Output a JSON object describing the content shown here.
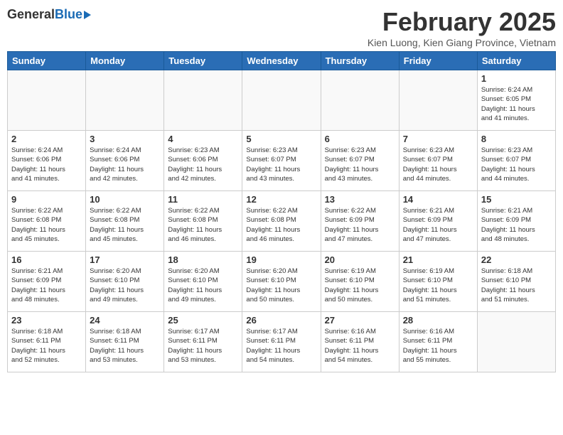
{
  "logo": {
    "general": "General",
    "blue": "Blue"
  },
  "title": "February 2025",
  "subtitle": "Kien Luong, Kien Giang Province, Vietnam",
  "days_of_week": [
    "Sunday",
    "Monday",
    "Tuesday",
    "Wednesday",
    "Thursday",
    "Friday",
    "Saturday"
  ],
  "weeks": [
    [
      {
        "day": "",
        "info": ""
      },
      {
        "day": "",
        "info": ""
      },
      {
        "day": "",
        "info": ""
      },
      {
        "day": "",
        "info": ""
      },
      {
        "day": "",
        "info": ""
      },
      {
        "day": "",
        "info": ""
      },
      {
        "day": "1",
        "info": "Sunrise: 6:24 AM\nSunset: 6:05 PM\nDaylight: 11 hours\nand 41 minutes."
      }
    ],
    [
      {
        "day": "2",
        "info": "Sunrise: 6:24 AM\nSunset: 6:06 PM\nDaylight: 11 hours\nand 41 minutes."
      },
      {
        "day": "3",
        "info": "Sunrise: 6:24 AM\nSunset: 6:06 PM\nDaylight: 11 hours\nand 42 minutes."
      },
      {
        "day": "4",
        "info": "Sunrise: 6:23 AM\nSunset: 6:06 PM\nDaylight: 11 hours\nand 42 minutes."
      },
      {
        "day": "5",
        "info": "Sunrise: 6:23 AM\nSunset: 6:07 PM\nDaylight: 11 hours\nand 43 minutes."
      },
      {
        "day": "6",
        "info": "Sunrise: 6:23 AM\nSunset: 6:07 PM\nDaylight: 11 hours\nand 43 minutes."
      },
      {
        "day": "7",
        "info": "Sunrise: 6:23 AM\nSunset: 6:07 PM\nDaylight: 11 hours\nand 44 minutes."
      },
      {
        "day": "8",
        "info": "Sunrise: 6:23 AM\nSunset: 6:07 PM\nDaylight: 11 hours\nand 44 minutes."
      }
    ],
    [
      {
        "day": "9",
        "info": "Sunrise: 6:22 AM\nSunset: 6:08 PM\nDaylight: 11 hours\nand 45 minutes."
      },
      {
        "day": "10",
        "info": "Sunrise: 6:22 AM\nSunset: 6:08 PM\nDaylight: 11 hours\nand 45 minutes."
      },
      {
        "day": "11",
        "info": "Sunrise: 6:22 AM\nSunset: 6:08 PM\nDaylight: 11 hours\nand 46 minutes."
      },
      {
        "day": "12",
        "info": "Sunrise: 6:22 AM\nSunset: 6:08 PM\nDaylight: 11 hours\nand 46 minutes."
      },
      {
        "day": "13",
        "info": "Sunrise: 6:22 AM\nSunset: 6:09 PM\nDaylight: 11 hours\nand 47 minutes."
      },
      {
        "day": "14",
        "info": "Sunrise: 6:21 AM\nSunset: 6:09 PM\nDaylight: 11 hours\nand 47 minutes."
      },
      {
        "day": "15",
        "info": "Sunrise: 6:21 AM\nSunset: 6:09 PM\nDaylight: 11 hours\nand 48 minutes."
      }
    ],
    [
      {
        "day": "16",
        "info": "Sunrise: 6:21 AM\nSunset: 6:09 PM\nDaylight: 11 hours\nand 48 minutes."
      },
      {
        "day": "17",
        "info": "Sunrise: 6:20 AM\nSunset: 6:10 PM\nDaylight: 11 hours\nand 49 minutes."
      },
      {
        "day": "18",
        "info": "Sunrise: 6:20 AM\nSunset: 6:10 PM\nDaylight: 11 hours\nand 49 minutes."
      },
      {
        "day": "19",
        "info": "Sunrise: 6:20 AM\nSunset: 6:10 PM\nDaylight: 11 hours\nand 50 minutes."
      },
      {
        "day": "20",
        "info": "Sunrise: 6:19 AM\nSunset: 6:10 PM\nDaylight: 11 hours\nand 50 minutes."
      },
      {
        "day": "21",
        "info": "Sunrise: 6:19 AM\nSunset: 6:10 PM\nDaylight: 11 hours\nand 51 minutes."
      },
      {
        "day": "22",
        "info": "Sunrise: 6:18 AM\nSunset: 6:10 PM\nDaylight: 11 hours\nand 51 minutes."
      }
    ],
    [
      {
        "day": "23",
        "info": "Sunrise: 6:18 AM\nSunset: 6:11 PM\nDaylight: 11 hours\nand 52 minutes."
      },
      {
        "day": "24",
        "info": "Sunrise: 6:18 AM\nSunset: 6:11 PM\nDaylight: 11 hours\nand 53 minutes."
      },
      {
        "day": "25",
        "info": "Sunrise: 6:17 AM\nSunset: 6:11 PM\nDaylight: 11 hours\nand 53 minutes."
      },
      {
        "day": "26",
        "info": "Sunrise: 6:17 AM\nSunset: 6:11 PM\nDaylight: 11 hours\nand 54 minutes."
      },
      {
        "day": "27",
        "info": "Sunrise: 6:16 AM\nSunset: 6:11 PM\nDaylight: 11 hours\nand 54 minutes."
      },
      {
        "day": "28",
        "info": "Sunrise: 6:16 AM\nSunset: 6:11 PM\nDaylight: 11 hours\nand 55 minutes."
      },
      {
        "day": "",
        "info": ""
      }
    ]
  ]
}
